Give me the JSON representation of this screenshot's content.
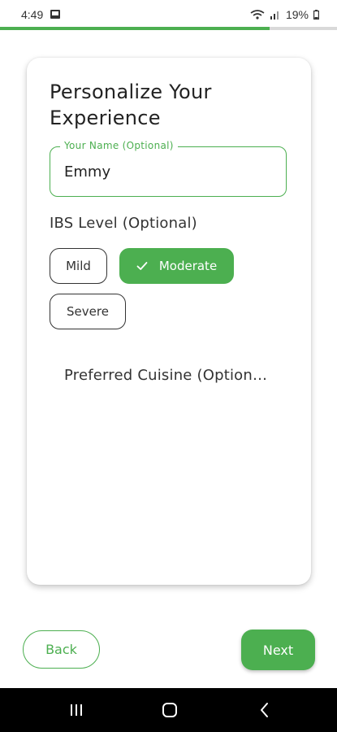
{
  "status_bar": {
    "time": "4:49",
    "battery": "19%"
  },
  "progress": {
    "fraction": 0.8
  },
  "card": {
    "title": "Personalize Your Experience",
    "name_field": {
      "label": "Your Name (Optional)",
      "value": "Emmy"
    },
    "ibs_level": {
      "label": "IBS Level (Optional)",
      "options": [
        "Mild",
        "Moderate",
        "Severe"
      ],
      "selected": "Moderate"
    },
    "cuisine_label": "Preferred Cuisine (Option…"
  },
  "actions": {
    "back_label": "Back",
    "next_label": "Next"
  },
  "colors": {
    "accent": "#4caf50",
    "text": "#222222",
    "nav_bar": "#000000"
  },
  "icons": [
    "image-icon",
    "wifi-icon",
    "signal-icon",
    "battery-icon",
    "check-icon",
    "recents-icon",
    "home-icon",
    "back-arrow-icon"
  ]
}
